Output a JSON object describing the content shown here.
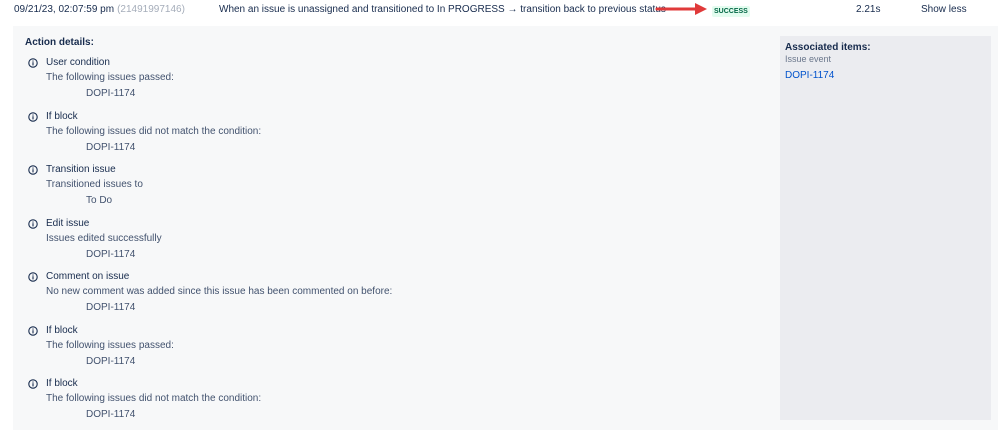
{
  "header": {
    "date": "09/21/23, 02:07:59 pm",
    "id": "(21491997146)",
    "rule_name": "When an issue is unassigned and transitioned to In PROGRESS → transition back to previous status",
    "status": "SUCCESS",
    "duration": "2.21s",
    "toggle_label": "Show less"
  },
  "details": {
    "title": "Action details:",
    "actions": [
      {
        "icon": "info-icon",
        "name": "User condition",
        "desc": "The following issues passed:",
        "value": "DOPI-1174"
      },
      {
        "icon": "info-icon",
        "name": "If block",
        "desc": "The following issues did not match the condition:",
        "value": "DOPI-1174"
      },
      {
        "icon": "info-icon",
        "name": "Transition issue",
        "desc": "Transitioned issues to",
        "value": "To Do"
      },
      {
        "icon": "info-icon",
        "name": "Edit issue",
        "desc": "Issues edited successfully",
        "value": "DOPI-1174"
      },
      {
        "icon": "info-icon",
        "name": "Comment on issue",
        "desc": "No new comment was added since this issue has been commented on before:",
        "value": "DOPI-1174"
      },
      {
        "icon": "info-icon",
        "name": "If block",
        "desc": "The following issues passed:",
        "value": "DOPI-1174"
      },
      {
        "icon": "info-icon",
        "name": "If block",
        "desc": "The following issues did not match the condition:",
        "value": "DOPI-1174"
      }
    ]
  },
  "associated": {
    "title": "Associated items:",
    "subtitle": "Issue event",
    "link": "DOPI-1174"
  },
  "colors": {
    "success_bg": "#e3fcef",
    "success_text": "#006644",
    "link": "#0052cc",
    "annotation_arrow": "#e03a3a"
  }
}
